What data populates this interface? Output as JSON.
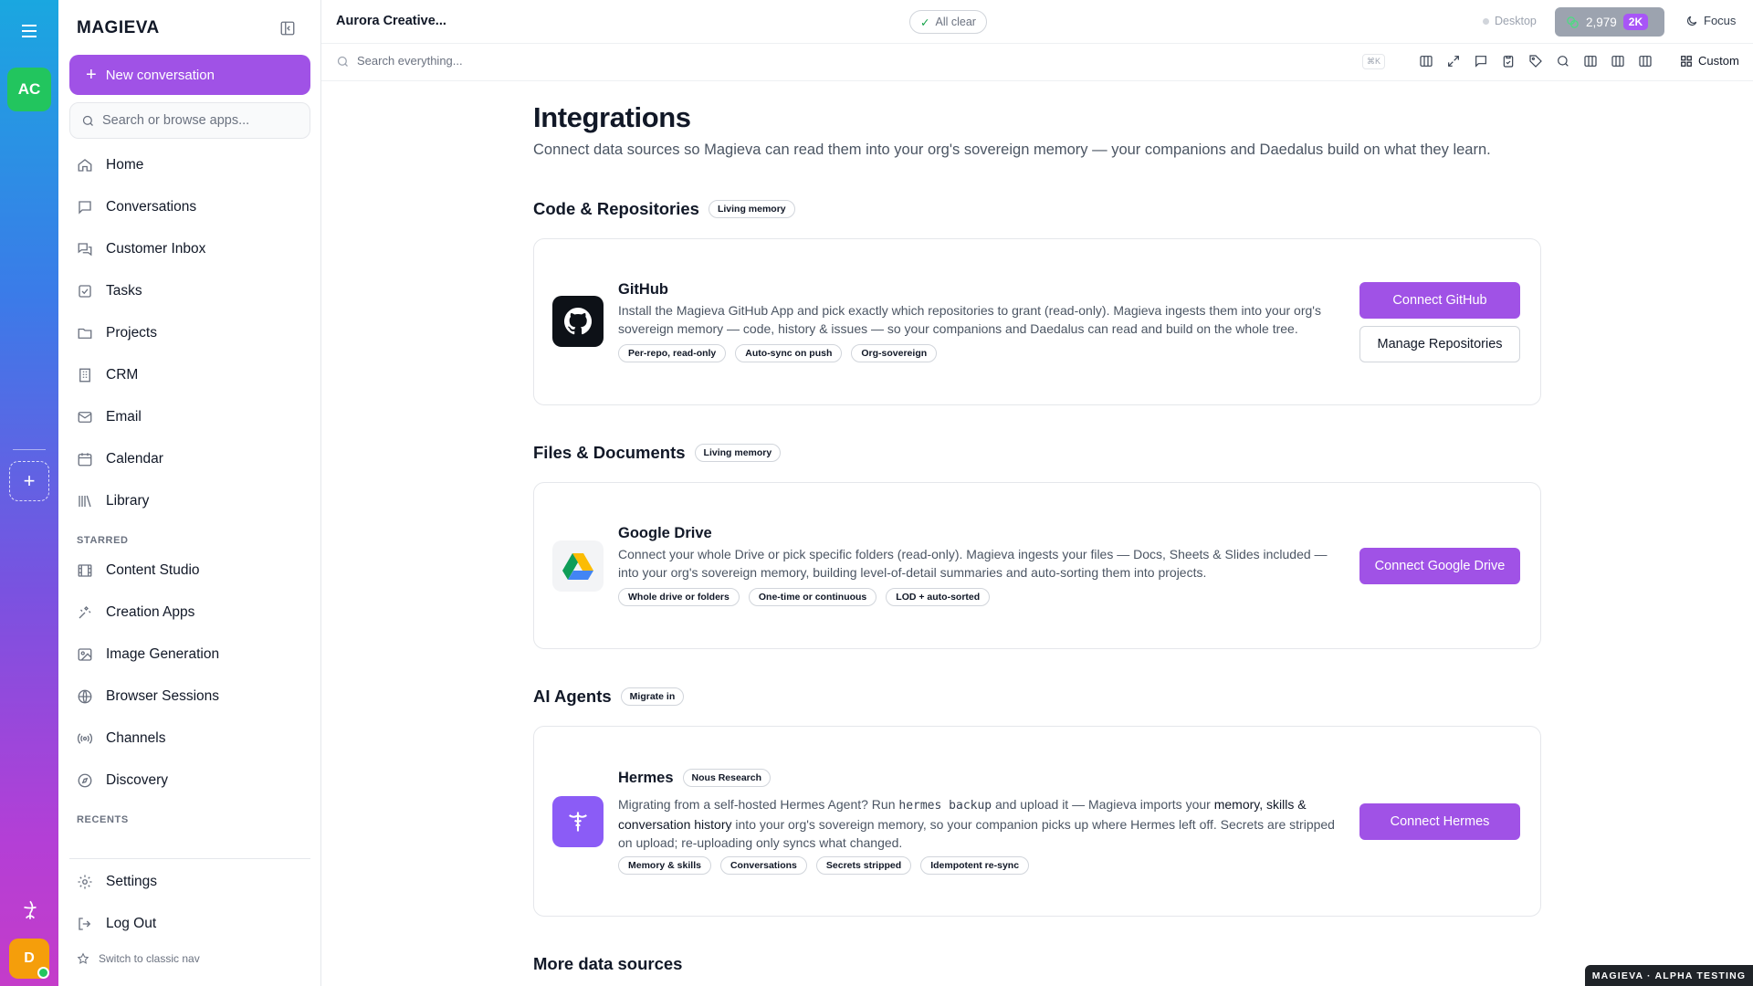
{
  "rail": {
    "workspace_initials": "AC",
    "add_label": "+",
    "user_initial": "D"
  },
  "sidebar": {
    "brand": "MAGIEVA",
    "new_conversation": "New conversation",
    "search_placeholder": "Search or browse apps...",
    "items": [
      {
        "label": "Home",
        "icon": "home-icon"
      },
      {
        "label": "Conversations",
        "icon": "chat-icon"
      },
      {
        "label": "Customer Inbox",
        "icon": "inbox-icon"
      },
      {
        "label": "Tasks",
        "icon": "checkbox-icon"
      },
      {
        "label": "Projects",
        "icon": "folder-icon"
      },
      {
        "label": "CRM",
        "icon": "building-icon"
      },
      {
        "label": "Email",
        "icon": "mail-icon"
      },
      {
        "label": "Calendar",
        "icon": "calendar-icon"
      },
      {
        "label": "Library",
        "icon": "library-icon"
      }
    ],
    "starred_label": "STARRED",
    "starred": [
      {
        "label": "Content Studio",
        "icon": "film-icon"
      },
      {
        "label": "Creation Apps",
        "icon": "apps-icon"
      },
      {
        "label": "Image Generation",
        "icon": "image-icon"
      },
      {
        "label": "Browser Sessions",
        "icon": "globe-icon"
      },
      {
        "label": "Channels",
        "icon": "radio-icon"
      },
      {
        "label": "Discovery",
        "icon": "compass-icon"
      }
    ],
    "recents_label": "RECENTS",
    "settings": "Settings",
    "logout": "Log Out",
    "classic_nav": "Switch to classic nav"
  },
  "topbar": {
    "title": "Aurora Creative...",
    "status": "All clear",
    "mode": "Desktop",
    "credits": "2,979",
    "credits_badge": "2K",
    "focus": "Focus"
  },
  "toolbar": {
    "search_placeholder": "Search everything...",
    "shortcut": "⌘K",
    "custom": "Custom"
  },
  "page": {
    "title": "Integrations",
    "subtitle": "Connect data sources so Magieva can read them into your org's sovereign memory — your companions and Daedalus build on what they learn."
  },
  "sections": {
    "code": {
      "title": "Code & Repositories",
      "chip": "Living memory"
    },
    "files": {
      "title": "Files & Documents",
      "chip": "Living memory"
    },
    "agents": {
      "title": "AI Agents",
      "chip": "Migrate in"
    },
    "more": {
      "title": "More data sources"
    }
  },
  "github": {
    "name": "GitHub",
    "desc": "Install the Magieva GitHub App and pick exactly which repositories to grant (read-only). Magieva ingests them into your org's sovereign memory — code, history & issues — so your companions and Daedalus can read and build on the whole tree.",
    "tags": [
      "Per-repo, read-only",
      "Auto-sync on push",
      "Org-sovereign"
    ],
    "connect": "Connect GitHub",
    "manage": "Manage Repositories"
  },
  "gdrive": {
    "name": "Google Drive",
    "desc": "Connect your whole Drive or pick specific folders (read-only). Magieva ingests your files — Docs, Sheets & Slides included — into your org's sovereign memory, building level-of-detail summaries and auto-sorting them into projects.",
    "tags": [
      "Whole drive or folders",
      "One-time or continuous",
      "LOD + auto-sorted"
    ],
    "connect": "Connect Google Drive"
  },
  "hermes": {
    "name": "Hermes",
    "chip": "Nous Research",
    "desc_a": "Migrating from a self-hosted Hermes Agent? Run ",
    "desc_code": "hermes backup",
    "desc_b": " and upload it — Magieva imports your ",
    "desc_bold": "memory, skills & conversation history",
    "desc_c": " into your org's sovereign memory, so your companion picks up where Hermes left off. Secrets are stripped on upload; re-uploading only syncs what changed.",
    "tags": [
      "Memory & skills",
      "Conversations",
      "Secrets stripped",
      "Idempotent re-sync"
    ],
    "connect": "Connect Hermes"
  },
  "badge": "MAGIEVA · ALPHA TESTING",
  "colors": {
    "accent": "#a052e6",
    "workspace": "#22c55e",
    "user": "#f59e0b",
    "success": "#16a34a"
  }
}
